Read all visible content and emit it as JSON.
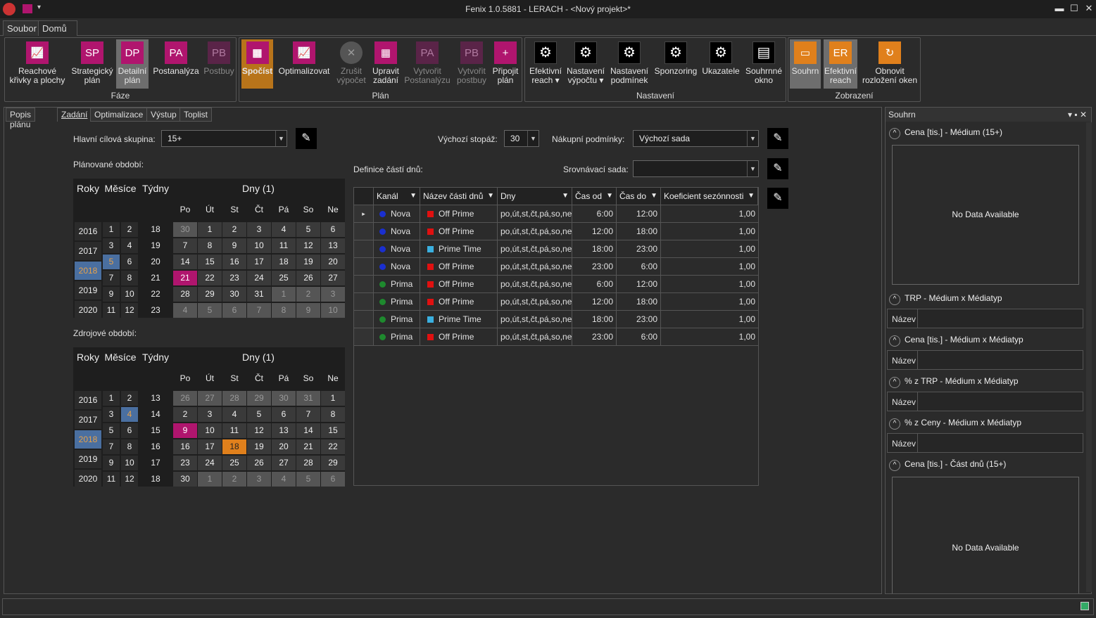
{
  "window": {
    "title": "Fenix 1.0.5881 - LERACH - <Nový projekt>*",
    "qa_arrow": "▾",
    "min": "▬",
    "max": "☐",
    "close": "✕"
  },
  "menu": {
    "tabs": [
      "Soubor",
      "Domů"
    ]
  },
  "ribbon": {
    "groups": [
      {
        "label": "Fáze"
      },
      {
        "label": "Plán"
      },
      {
        "label": "Nastavení"
      },
      {
        "label": "Zobrazení"
      }
    ],
    "buttons": {
      "reach": {
        "icon_text": "📈",
        "label1": "Reachové",
        "label2": "křivky a plochy"
      },
      "sp": {
        "icon_text": "SP",
        "label1": "Strategický",
        "label2": "plán"
      },
      "dp": {
        "icon_text": "DP",
        "label1": "Detailní",
        "label2": "plán"
      },
      "pa": {
        "icon_text": "PA",
        "label1": "Postanalýza",
        "label2": ""
      },
      "pb": {
        "icon_text": "PB",
        "label1": "Postbuy",
        "label2": ""
      },
      "spocist": {
        "icon_text": "▦",
        "label1": "Spočíst",
        "label2": ""
      },
      "optimalizovat": {
        "icon_text": "📈",
        "label1": "Optimalizovat",
        "label2": ""
      },
      "zrusit": {
        "icon_text": "✕",
        "label1": "Zrušit",
        "label2": "výpočet"
      },
      "upravit": {
        "icon_text": "▦",
        "label1": "Upravit",
        "label2": "zadání"
      },
      "vytvorit_pa": {
        "icon_text": "PA",
        "label1": "Vytvořit",
        "label2": "Postanalýzu"
      },
      "vytvorit_pb": {
        "icon_text": "PB",
        "label1": "Vytvořit",
        "label2": "postbuy"
      },
      "pripojit": {
        "icon_text": "+",
        "label1": "Připojit",
        "label2": "plán"
      },
      "efektivni": {
        "icon_text": "⚙",
        "label1": "Efektivní",
        "label2": "reach ▾"
      },
      "nast_vypoctu": {
        "icon_text": "⚙",
        "label1": "Nastavení",
        "label2": "výpočtu ▾"
      },
      "nast_podminek": {
        "icon_text": "⚙",
        "label1": "Nastavení",
        "label2": "podmínek"
      },
      "sponzoring": {
        "icon_text": "⚙",
        "label1": "Sponzoring",
        "label2": ""
      },
      "ukazatele": {
        "icon_text": "⚙",
        "label1": "Ukazatele",
        "label2": ""
      },
      "souhrnne": {
        "icon_text": "▤",
        "label1": "Souhrnné",
        "label2": "okno"
      },
      "souhrn": {
        "icon_text": "▭",
        "label1": "Souhrn",
        "label2": ""
      },
      "er": {
        "icon_text": "ER",
        "label1": "Efektivní",
        "label2": "reach"
      },
      "obnovit": {
        "icon_text": "↻",
        "label1": "Obnovit",
        "label2": "rozložení oken"
      }
    }
  },
  "content_tabs": [
    "Popis plánu",
    "Zadání",
    "Optimalizace",
    "Výstup",
    "Toplist"
  ],
  "form": {
    "target_label": "Hlavní cílová skupina:",
    "target_value": "15+",
    "stopaz_label": "Výchozí stopáž:",
    "stopaz_value": "30",
    "nakup_label": "Nákupní podmínky:",
    "nakup_value": "Výchozí sada",
    "srovnavaci_label": "Srovnávací sada:",
    "srovnavaci_value": "",
    "definice_label": "Definice částí dnů:",
    "planned_label": "Plánované období:",
    "source_label": "Zdrojové období:",
    "pen": "✎",
    "arrow": "▼"
  },
  "calendar_headers": {
    "roky": "Roky",
    "mesice": "Měsíce",
    "tydny": "Týdny",
    "dny": "Dny (1)",
    "weekdays": [
      "Po",
      "Út",
      "St",
      "Čt",
      "Pá",
      "So",
      "Ne"
    ]
  },
  "planned": {
    "years": [
      "2016",
      "2017",
      "2018",
      "2019",
      "2020"
    ],
    "months": [
      [
        "1",
        "2"
      ],
      [
        "3",
        "4"
      ],
      [
        "5",
        "6"
      ],
      [
        "7",
        "8"
      ],
      [
        "9",
        "10"
      ],
      [
        "11",
        "12"
      ]
    ],
    "weeks": [
      "18",
      "19",
      "20",
      "21",
      "22",
      "23"
    ],
    "days": [
      [
        "30",
        "1",
        "2",
        "3",
        "4",
        "5",
        "6"
      ],
      [
        "7",
        "8",
        "9",
        "10",
        "11",
        "12",
        "13"
      ],
      [
        "14",
        "15",
        "16",
        "17",
        "18",
        "19",
        "20"
      ],
      [
        "21",
        "22",
        "23",
        "24",
        "25",
        "26",
        "27"
      ],
      [
        "28",
        "29",
        "30",
        "31",
        "1",
        "2",
        "3"
      ],
      [
        "4",
        "5",
        "6",
        "7",
        "8",
        "9",
        "10"
      ]
    ]
  },
  "source": {
    "years": [
      "2016",
      "2017",
      "2018",
      "2019",
      "2020"
    ],
    "months": [
      [
        "1",
        "2"
      ],
      [
        "3",
        "4"
      ],
      [
        "5",
        "6"
      ],
      [
        "7",
        "8"
      ],
      [
        "9",
        "10"
      ],
      [
        "11",
        "12"
      ]
    ],
    "weeks": [
      "13",
      "14",
      "15",
      "16",
      "17",
      "18"
    ],
    "days": [
      [
        "26",
        "27",
        "28",
        "29",
        "30",
        "31",
        "1"
      ],
      [
        "2",
        "3",
        "4",
        "5",
        "6",
        "7",
        "8"
      ],
      [
        "9",
        "10",
        "11",
        "12",
        "13",
        "14",
        "15"
      ],
      [
        "16",
        "17",
        "18",
        "19",
        "20",
        "21",
        "22"
      ],
      [
        "23",
        "24",
        "25",
        "26",
        "27",
        "28",
        "29"
      ],
      [
        "30",
        "1",
        "2",
        "3",
        "4",
        "5",
        "6"
      ]
    ]
  },
  "grid": {
    "columns": [
      "Kanál",
      "Název části dnů",
      "Dny",
      "Čas od",
      "Čas do",
      "Koeficient sezónnosti"
    ],
    "filter_icon": "▼",
    "row_marker": "▸",
    "rows": [
      {
        "kanal": "Nova",
        "nazev": "Off Prime",
        "dny": "po,út,st,čt,pá,so,ne",
        "od": "6:00",
        "do": "12:00",
        "koef": "1,00",
        "dot": "#1a2fd0",
        "sq": "#e01010"
      },
      {
        "kanal": "Nova",
        "nazev": "Off Prime",
        "dny": "po,út,st,čt,pá,so,ne",
        "od": "12:00",
        "do": "18:00",
        "koef": "1,00",
        "dot": "#1a2fd0",
        "sq": "#e01010"
      },
      {
        "kanal": "Nova",
        "nazev": "Prime Time",
        "dny": "po,út,st,čt,pá,so,ne",
        "od": "18:00",
        "do": "23:00",
        "koef": "1,00",
        "dot": "#1a2fd0",
        "sq": "#3ab0e0"
      },
      {
        "kanal": "Nova",
        "nazev": "Off Prime",
        "dny": "po,út,st,čt,pá,so,ne",
        "od": "23:00",
        "do": "6:00",
        "koef": "1,00",
        "dot": "#1a2fd0",
        "sq": "#e01010"
      },
      {
        "kanal": "Prima",
        "nazev": "Off Prime",
        "dny": "po,út,st,čt,pá,so,ne",
        "od": "6:00",
        "do": "12:00",
        "koef": "1,00",
        "dot": "#1e8a2e",
        "sq": "#e01010"
      },
      {
        "kanal": "Prima",
        "nazev": "Off Prime",
        "dny": "po,út,st,čt,pá,so,ne",
        "od": "12:00",
        "do": "18:00",
        "koef": "1,00",
        "dot": "#1e8a2e",
        "sq": "#e01010"
      },
      {
        "kanal": "Prima",
        "nazev": "Prime Time",
        "dny": "po,út,st,čt,pá,so,ne",
        "od": "18:00",
        "do": "23:00",
        "koef": "1,00",
        "dot": "#1e8a2e",
        "sq": "#3ab0e0"
      },
      {
        "kanal": "Prima",
        "nazev": "Off Prime",
        "dny": "po,út,st,čt,pá,so,ne",
        "od": "23:00",
        "do": "6:00",
        "koef": "1,00",
        "dot": "#1e8a2e",
        "sq": "#e01010"
      }
    ]
  },
  "summary": {
    "title": "Souhrn",
    "controls": "▾ ▪ ✕",
    "collapse": "^",
    "s1": "Cena [tis.] - Médium (15+)",
    "s2": "TRP - Médium x Médiatyp",
    "s3": "Cena [tis.] - Médium x Médiatyp",
    "s4": "% z TRP - Médium x Médiatyp",
    "s5": "% z Ceny - Médium x Médiatyp",
    "s6": "Cena [tis.] - Část dnů (15+)",
    "no_data": "No Data Available",
    "nazev": "Název"
  },
  "colors": {
    "magenta": "#b0156e",
    "orange": "#e0801c",
    "blue_sel": "#4a6fa0"
  }
}
